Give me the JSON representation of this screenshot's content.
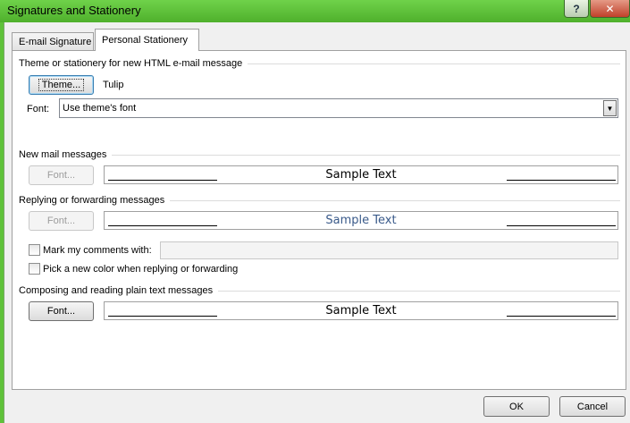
{
  "window": {
    "title": "Signatures and Stationery",
    "help_label": "?",
    "close_label": "✕"
  },
  "tabs": [
    {
      "label": "E-mail Signature",
      "active": false
    },
    {
      "label": "Personal Stationery",
      "active": true
    }
  ],
  "theme_group": {
    "label": "Theme or stationery for new HTML e-mail message",
    "theme_button": "Theme...",
    "theme_name": "Tulip",
    "font_label": "Font:",
    "font_value": "Use theme's font"
  },
  "new_mail": {
    "label": "New mail messages",
    "font_button": "Font...",
    "sample_text": "Sample Text"
  },
  "reply": {
    "label": "Replying or forwarding messages",
    "font_button": "Font...",
    "sample_text": "Sample Text",
    "sample_color": "#3a5a8a",
    "mark_comments_label": "Mark my comments with:",
    "pick_color_label": "Pick a new color when replying or forwarding"
  },
  "plain_text": {
    "label": "Composing and reading plain text messages",
    "font_button": "Font...",
    "sample_text": "Sample Text"
  },
  "footer": {
    "ok_label": "OK",
    "cancel_label": "Cancel"
  }
}
